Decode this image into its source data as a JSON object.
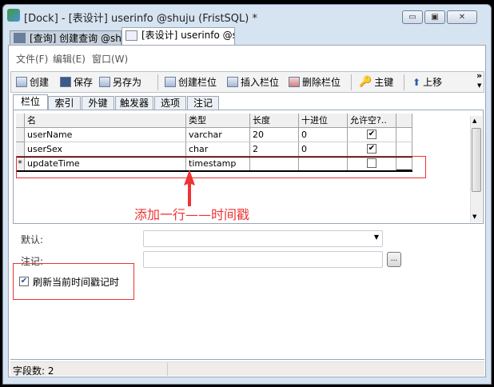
{
  "window": {
    "title": "[Dock] - [表设计] userinfo @shuju (FristSQL) *",
    "minimize": "▭",
    "maximize": "▣",
    "close": "✕"
  },
  "doc_tabs": [
    {
      "label": "[查询] 创建查询 @shuju..."
    },
    {
      "label": "[表设计] userinfo @shuj..."
    }
  ],
  "menu": [
    "文件(F)",
    "编辑(E)",
    "窗口(W)"
  ],
  "toolbar": {
    "create": "创建",
    "save": "保存",
    "save_as": "另存为",
    "create_field": "创建栏位",
    "insert_field": "插入栏位",
    "delete_field": "删除栏位",
    "primary_key": "主键",
    "move_up": "上移",
    "more": "»"
  },
  "sub_tabs": [
    "栏位",
    "索引",
    "外键",
    "触发器",
    "选项",
    "注记"
  ],
  "grid": {
    "headers": [
      "名",
      "类型",
      "长度",
      "十进位",
      "允许空?.."
    ],
    "rows": [
      {
        "marker": "",
        "name": "userName",
        "type": "varchar",
        "length": "20",
        "decimal": "0",
        "nullable": true
      },
      {
        "marker": "",
        "name": "userSex",
        "type": "char",
        "length": "2",
        "decimal": "0",
        "nullable": true
      },
      {
        "marker": "*",
        "name": "updateTime",
        "type": "timestamp",
        "length": "",
        "decimal": "",
        "nullable": false
      }
    ]
  },
  "annotation": "添加一行——时间戳",
  "props": {
    "default_label": "默认:",
    "default_value": "",
    "comment_label": "注记:",
    "comment_value": "",
    "browse": "...",
    "refresh_checkbox": "刷新当前时间戳记时",
    "refresh_checked": true
  },
  "status": {
    "field_count": "字段数: 2"
  },
  "colors": {
    "annotation": "#ee3333"
  }
}
